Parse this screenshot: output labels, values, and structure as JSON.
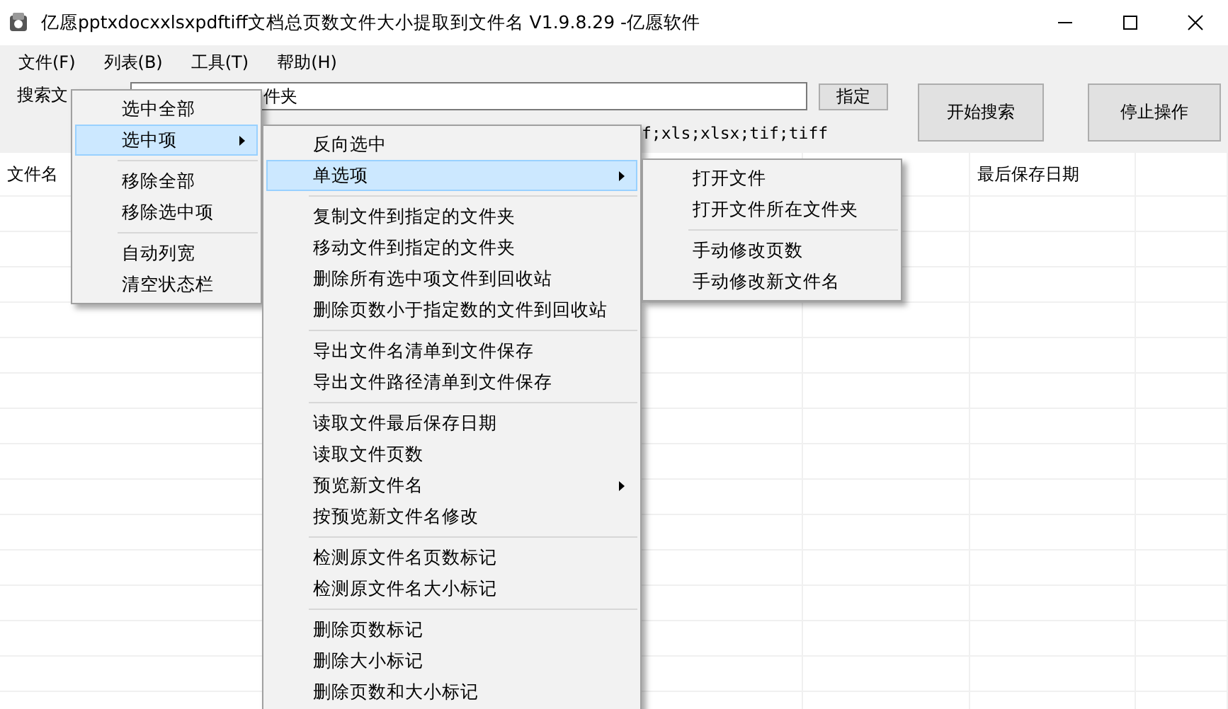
{
  "window": {
    "title": "亿愿pptxdocxxlsxpdftiff文档总页数文件大小提取到文件名 V1.9.8.29 -亿愿软件"
  },
  "menubar": [
    "文件(F)",
    "列表(B)",
    "工具(T)",
    "帮助(H)"
  ],
  "search": {
    "label": "搜索文",
    "folder_value": "件夹",
    "extensions": "f;xls;xlsx;tif;tiff",
    "assign_button": "指定",
    "start_button": "开始搜索",
    "stop_button": "停止操作"
  },
  "table": {
    "columns": [
      "文件名",
      "最后保存日期"
    ]
  },
  "menus": [
    {
      "items": [
        {
          "kind": "item",
          "label": "选中全部",
          "selected": false,
          "submenu": false
        },
        {
          "kind": "item",
          "label": "选中项",
          "selected": true,
          "submenu": true
        },
        {
          "kind": "separator"
        },
        {
          "kind": "item",
          "label": "移除全部",
          "selected": false,
          "submenu": false
        },
        {
          "kind": "item",
          "label": "移除选中项",
          "selected": false,
          "submenu": false
        },
        {
          "kind": "separator"
        },
        {
          "kind": "item",
          "label": "自动列宽",
          "selected": false,
          "submenu": false
        },
        {
          "kind": "item",
          "label": "清空状态栏",
          "selected": false,
          "submenu": false
        }
      ]
    },
    {
      "items": [
        {
          "kind": "item",
          "label": "反向选中",
          "selected": false,
          "submenu": false
        },
        {
          "kind": "item",
          "label": "单选项",
          "selected": true,
          "submenu": true
        },
        {
          "kind": "separator"
        },
        {
          "kind": "item",
          "label": "复制文件到指定的文件夹",
          "selected": false,
          "submenu": false
        },
        {
          "kind": "item",
          "label": "移动文件到指定的文件夹",
          "selected": false,
          "submenu": false
        },
        {
          "kind": "item",
          "label": "删除所有选中项文件到回收站",
          "selected": false,
          "submenu": false
        },
        {
          "kind": "item",
          "label": "删除页数小于指定数的文件到回收站",
          "selected": false,
          "submenu": false
        },
        {
          "kind": "separator"
        },
        {
          "kind": "item",
          "label": "导出文件名清单到文件保存",
          "selected": false,
          "submenu": false
        },
        {
          "kind": "item",
          "label": "导出文件路径清单到文件保存",
          "selected": false,
          "submenu": false
        },
        {
          "kind": "separator"
        },
        {
          "kind": "item",
          "label": "读取文件最后保存日期",
          "selected": false,
          "submenu": false
        },
        {
          "kind": "item",
          "label": "读取文件页数",
          "selected": false,
          "submenu": false
        },
        {
          "kind": "item",
          "label": "预览新文件名",
          "selected": false,
          "submenu": true
        },
        {
          "kind": "item",
          "label": "按预览新文件名修改",
          "selected": false,
          "submenu": false
        },
        {
          "kind": "separator"
        },
        {
          "kind": "item",
          "label": "检测原文件名页数标记",
          "selected": false,
          "submenu": false
        },
        {
          "kind": "item",
          "label": "检测原文件名大小标记",
          "selected": false,
          "submenu": false
        },
        {
          "kind": "separator"
        },
        {
          "kind": "item",
          "label": "删除页数标记",
          "selected": false,
          "submenu": false
        },
        {
          "kind": "item",
          "label": "删除大小标记",
          "selected": false,
          "submenu": false
        },
        {
          "kind": "item",
          "label": "删除页数和大小标记",
          "selected": false,
          "submenu": false
        }
      ]
    },
    {
      "items": [
        {
          "kind": "item",
          "label": "打开文件",
          "selected": false,
          "submenu": false
        },
        {
          "kind": "item",
          "label": "打开文件所在文件夹",
          "selected": false,
          "submenu": false
        },
        {
          "kind": "separator"
        },
        {
          "kind": "item",
          "label": "手动修改页数",
          "selected": false,
          "submenu": false
        },
        {
          "kind": "item",
          "label": "手动修改新文件名",
          "selected": false,
          "submenu": false
        }
      ]
    }
  ]
}
